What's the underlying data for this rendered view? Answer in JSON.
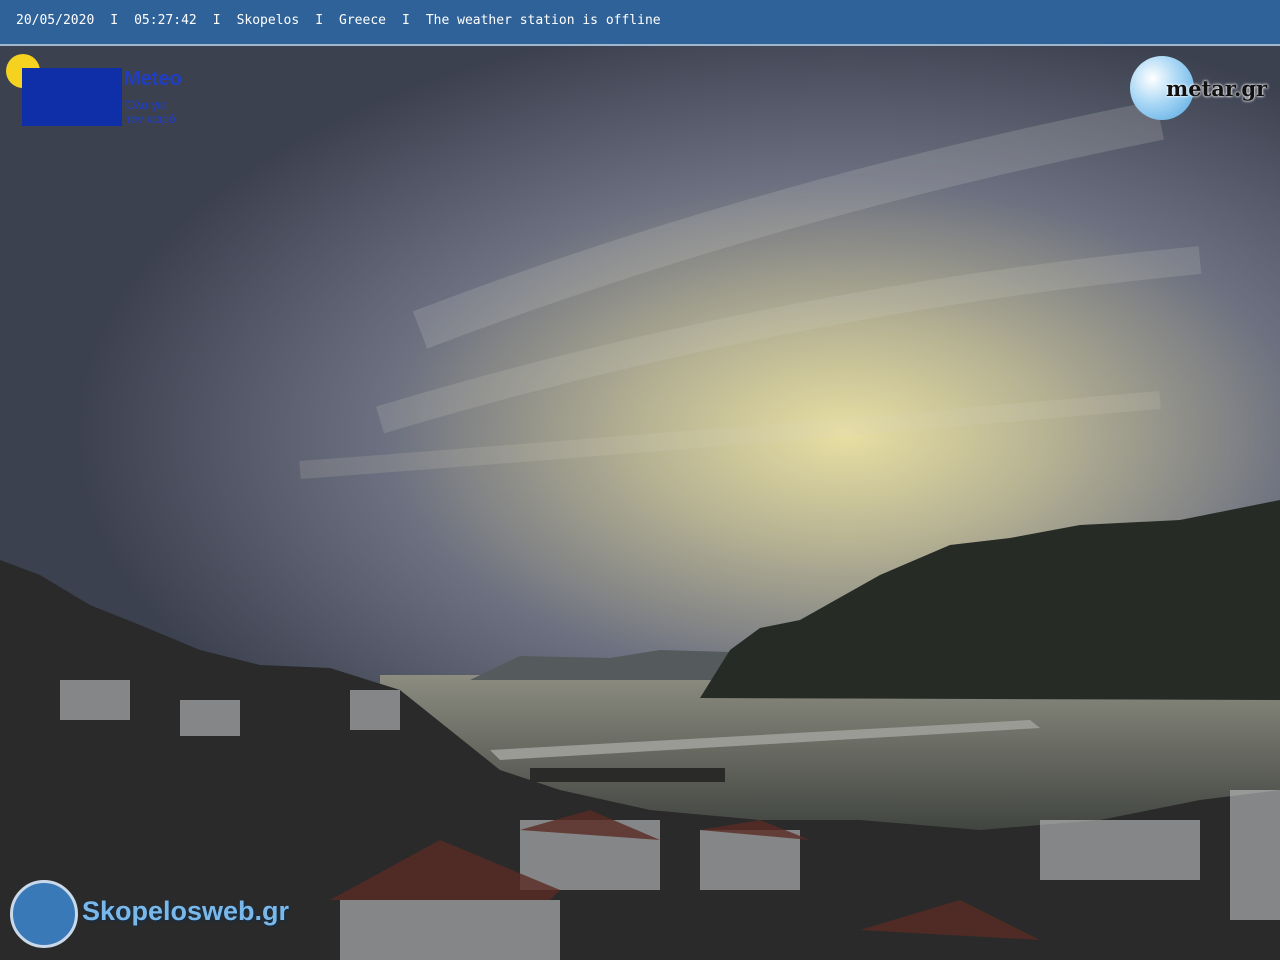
{
  "header": {
    "date": "20/05/2020",
    "time": "05:27:42",
    "location": "Skopelos",
    "country": "Greece",
    "status": "The weather station is offline",
    "separator": "I"
  },
  "logos": {
    "meteo": {
      "name": "Meteo",
      "tagline_line1": "Όλα για",
      "tagline_line2": "τον καιρό"
    },
    "metar": {
      "text": "metar.gr"
    },
    "skopelosweb": {
      "text": "Skopelosweb.gr"
    }
  },
  "colors": {
    "header_bg": "#2f6299",
    "meteo_blue": "#0e2fa8",
    "sun_yellow": "#f4d21f"
  }
}
